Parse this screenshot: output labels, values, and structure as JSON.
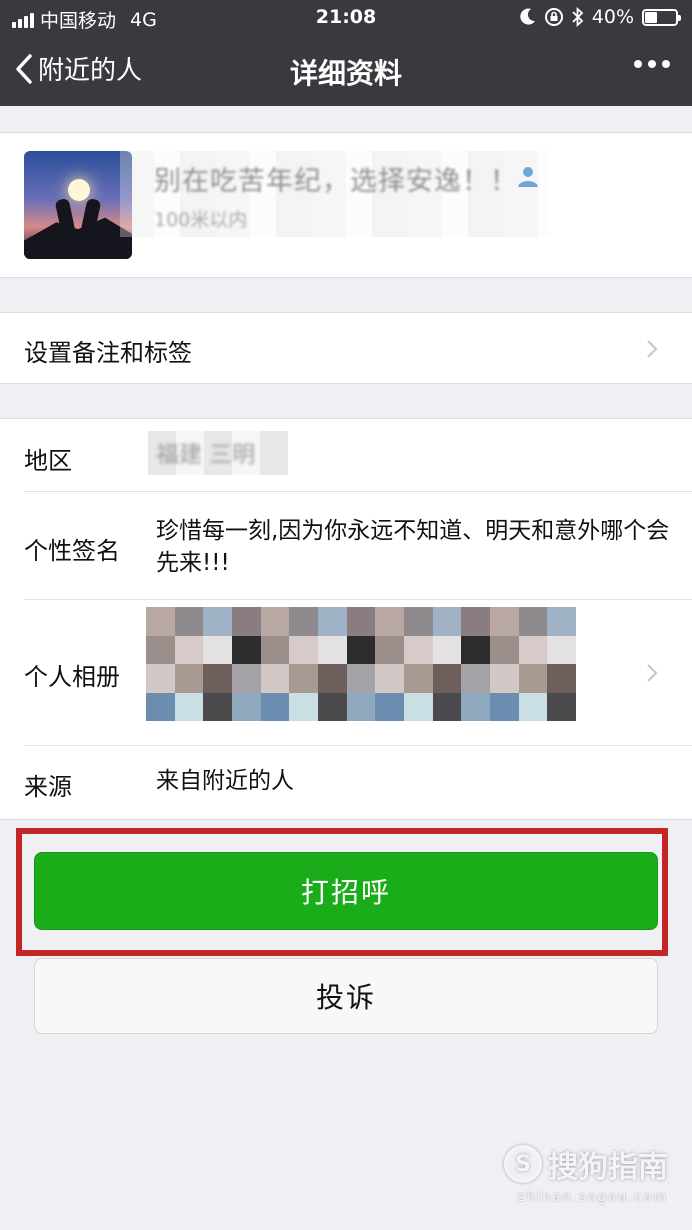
{
  "status_bar": {
    "carrier": "中国移动",
    "network": "4G",
    "time": "21:08",
    "battery": "40%",
    "battery_level": 0.4
  },
  "nav": {
    "back_label": "附近的人",
    "title": "详细资料"
  },
  "profile": {
    "nickname": "别在吃苦年纪，选择安逸！！",
    "distance": "100米以内"
  },
  "remark_row": {
    "label": "设置备注和标签"
  },
  "info": {
    "region_label": "地区",
    "region_value": "福建 三明",
    "signature_label": "个性签名",
    "signature_value": "珍惜每一刻,因为你永远不知道、明天和意外哪个会先来!!!",
    "album_label": "个人相册",
    "source_label": "来源",
    "source_value": "来自附近的人"
  },
  "actions": {
    "greet_label": "打招呼",
    "report_label": "投诉"
  },
  "watermark": {
    "main": "搜狗指南",
    "sub": "zhinan.sogou.com"
  },
  "colors": {
    "nav_bg": "#393a3f",
    "page_bg": "#efeff4",
    "green_button": "#1aad19",
    "highlight_border": "#c42525"
  }
}
